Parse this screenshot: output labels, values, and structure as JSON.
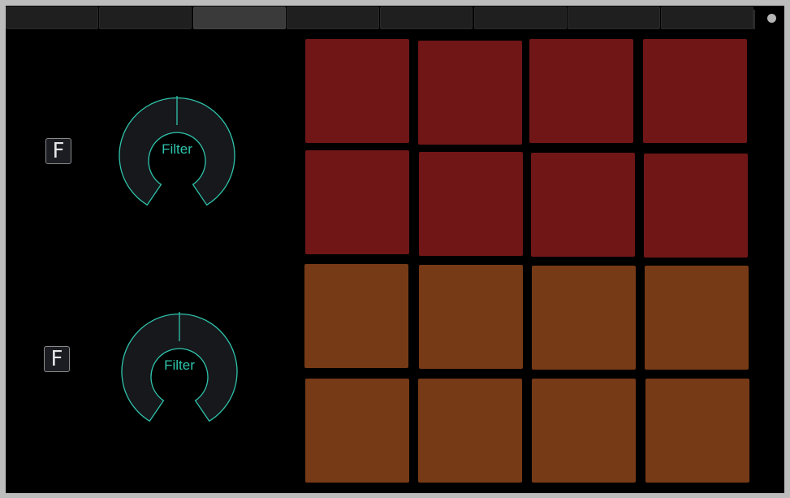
{
  "tabs": [
    {
      "label": "",
      "active": false
    },
    {
      "label": "",
      "active": false
    },
    {
      "label": "",
      "active": true
    },
    {
      "label": "",
      "active": false
    },
    {
      "label": "",
      "active": false
    },
    {
      "label": "",
      "active": false
    },
    {
      "label": "",
      "active": false
    },
    {
      "label": "",
      "active": false
    }
  ],
  "toggles": [
    {
      "label": "F"
    },
    {
      "label": "F"
    }
  ],
  "knobs": [
    {
      "label": "Filter",
      "value": 0.5
    },
    {
      "label": "Filter",
      "value": 0.5
    }
  ],
  "pads": {
    "rows": [
      {
        "color": "#701616",
        "count": 4
      },
      {
        "color": "#701616",
        "count": 4
      },
      {
        "color": "#773a16",
        "count": 4
      },
      {
        "color": "#773a16",
        "count": 4
      }
    ]
  },
  "colors": {
    "accent": "#2ec4ab",
    "pad_red": "#701616",
    "pad_orange": "#773a16",
    "knob_track": "#17181c",
    "background": "#000000"
  }
}
